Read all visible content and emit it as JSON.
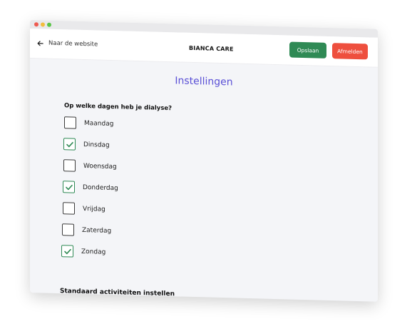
{
  "window": {
    "back_label": "Naar de website",
    "brand": "BIANCA CARE",
    "save_label": "Opslaan",
    "logout_label": "Afmelden"
  },
  "settings": {
    "title": "Instellingen",
    "question": "Op welke dagen heb je dialyse?",
    "days": [
      {
        "label": "Maandag",
        "checked": false
      },
      {
        "label": "Dinsdag",
        "checked": true
      },
      {
        "label": "Woensdag",
        "checked": false
      },
      {
        "label": "Donderdag",
        "checked": true
      },
      {
        "label": "Vrijdag",
        "checked": false
      },
      {
        "label": "Zaterdag",
        "checked": false
      },
      {
        "label": "Zondag",
        "checked": true
      }
    ],
    "section_title": "Standaard activiteiten instellen"
  },
  "colors": {
    "accent_title": "#5a50d6",
    "save": "#2f8a55",
    "logout": "#ee4f3e",
    "check": "#2f8a55"
  }
}
